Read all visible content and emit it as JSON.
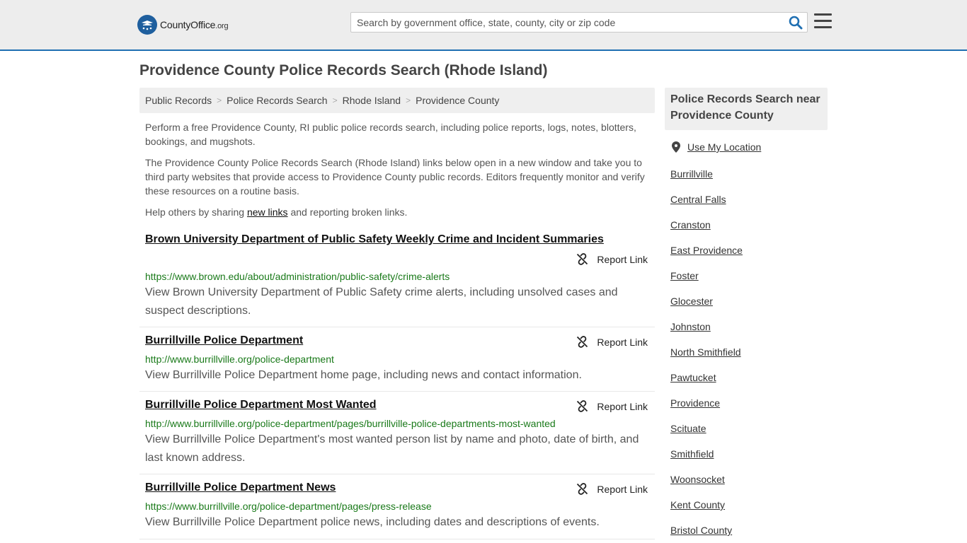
{
  "header": {
    "logo_main": "CountyOffice",
    "logo_suffix": ".org",
    "search_placeholder": "Search by government office, state, county, city or zip code"
  },
  "page": {
    "title": "Providence County Police Records Search (Rhode Island)"
  },
  "breadcrumb": [
    "Public Records",
    "Police Records Search",
    "Rhode Island",
    "Providence County"
  ],
  "intro": {
    "p1": "Perform a free Providence County, RI public police records search, including police reports, logs, notes, blotters, bookings, and mugshots.",
    "p2": "The Providence County Police Records Search (Rhode Island) links below open in a new window and take you to third party websites that provide access to Providence County public records. Editors frequently monitor and verify these resources on a routine basis.",
    "p3_before": "Help others by sharing ",
    "p3_link": "new links",
    "p3_after": " and reporting broken links."
  },
  "report_label": "Report Link",
  "results": [
    {
      "title": "Brown University Department of Public Safety Weekly Crime and Incident Summaries",
      "url": "https://www.brown.edu/about/administration/public-safety/crime-alerts",
      "desc": "View Brown University Department of Public Safety crime alerts, including unsolved cases and suspect descriptions."
    },
    {
      "title": "Burrillville Police Department",
      "url": "http://www.burrillville.org/police-department",
      "desc": "View Burrillville Police Department home page, including news and contact information."
    },
    {
      "title": "Burrillville Police Department Most Wanted",
      "url": "http://www.burrillville.org/police-department/pages/burrillville-police-departments-most-wanted",
      "desc": "View Burrillville Police Department's most wanted person list by name and photo, date of birth, and last known address."
    },
    {
      "title": "Burrillville Police Department News",
      "url": "https://www.burrillville.org/police-department/pages/press-release",
      "desc": "View Burrillville Police Department police news, including dates and descriptions of events."
    }
  ],
  "sidebar": {
    "heading": "Police Records Search near Providence County",
    "use_location": "Use My Location",
    "links": [
      "Burrillville",
      "Central Falls",
      "Cranston",
      "East Providence",
      "Foster",
      "Glocester",
      "Johnston",
      "North Smithfield",
      "Pawtucket",
      "Providence",
      "Scituate",
      "Smithfield",
      "Woonsocket",
      "Kent County",
      "Bristol County"
    ]
  },
  "icons": {
    "logo": "seal-icon",
    "search": "search-icon",
    "menu": "hamburger-menu-icon",
    "report": "broken-link-icon",
    "location": "map-pin-icon"
  },
  "colors": {
    "accent": "#1f6fb2",
    "url_green": "#1a7a1a",
    "header_bg": "#ededed"
  }
}
